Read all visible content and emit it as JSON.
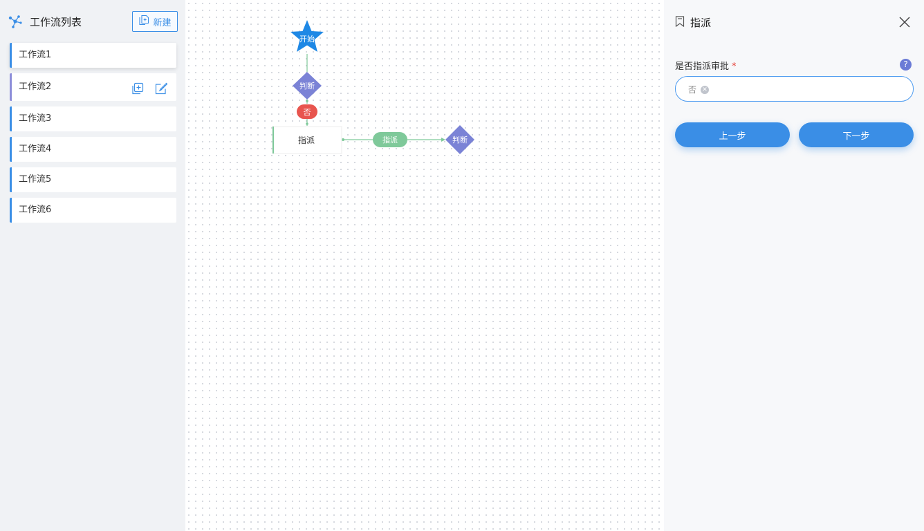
{
  "sidebar": {
    "title": "工作流列表",
    "new_button": "新建",
    "items": [
      {
        "label": "工作流1"
      },
      {
        "label": "工作流2"
      },
      {
        "label": "工作流3"
      },
      {
        "label": "工作流4"
      },
      {
        "label": "工作流5"
      },
      {
        "label": "工作流6"
      }
    ]
  },
  "canvas": {
    "nodes": {
      "start": "开始",
      "judge1": "判断",
      "no_label": "否",
      "assign": "指派",
      "edge_label": "指派",
      "judge2": "判断"
    }
  },
  "panel": {
    "title": "指派",
    "field_label": "是否指派审批",
    "required_mark": "*",
    "help": "?",
    "selected_value": "否",
    "prev_button": "上一步",
    "next_button": "下一步"
  },
  "colors": {
    "primary": "#3a8ee6",
    "start_node": "#1e88e5",
    "judge_node": "#7b83d6",
    "no_badge": "#e8554e",
    "edge": "#7fc99a"
  }
}
